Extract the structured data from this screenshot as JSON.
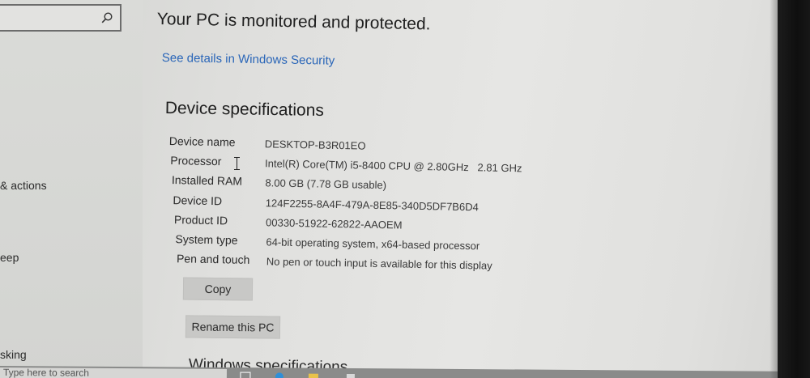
{
  "nav": {
    "search_icon": "search-icon",
    "items": [
      {
        "label": "& actions"
      },
      {
        "label": "eep"
      },
      {
        "label": "sking"
      }
    ]
  },
  "main": {
    "status_title": "Your PC is monitored and protected.",
    "security_link": "See details in Windows Security",
    "device_spec_heading": "Device specifications",
    "specs": [
      {
        "label": "Device name",
        "value": "DESKTOP-B3R01EO"
      },
      {
        "label": "Processor",
        "value": "Intel(R) Core(TM) i5-8400 CPU @ 2.80GHz   2.81 GHz"
      },
      {
        "label": "Installed RAM",
        "value": "8.00 GB (7.78 GB usable)"
      },
      {
        "label": "Device ID",
        "value": "124F2255-8A4F-479A-8E85-340D5DF7B6D4"
      },
      {
        "label": "Product ID",
        "value": "00330-51922-62822-AAOEM"
      },
      {
        "label": "System type",
        "value": "64-bit operating system, x64-based processor"
      },
      {
        "label": "Pen and touch",
        "value": "No pen or touch input is available for this display"
      }
    ],
    "copy_label": "Copy",
    "rename_label": "Rename this PC",
    "windows_spec_heading": "Windows specifications"
  },
  "taskbar": {
    "search_text": "Type here to search"
  },
  "colors": {
    "link": "#2a66b8",
    "button_bg": "#c8c8c6",
    "text": "#1f1f1f"
  }
}
